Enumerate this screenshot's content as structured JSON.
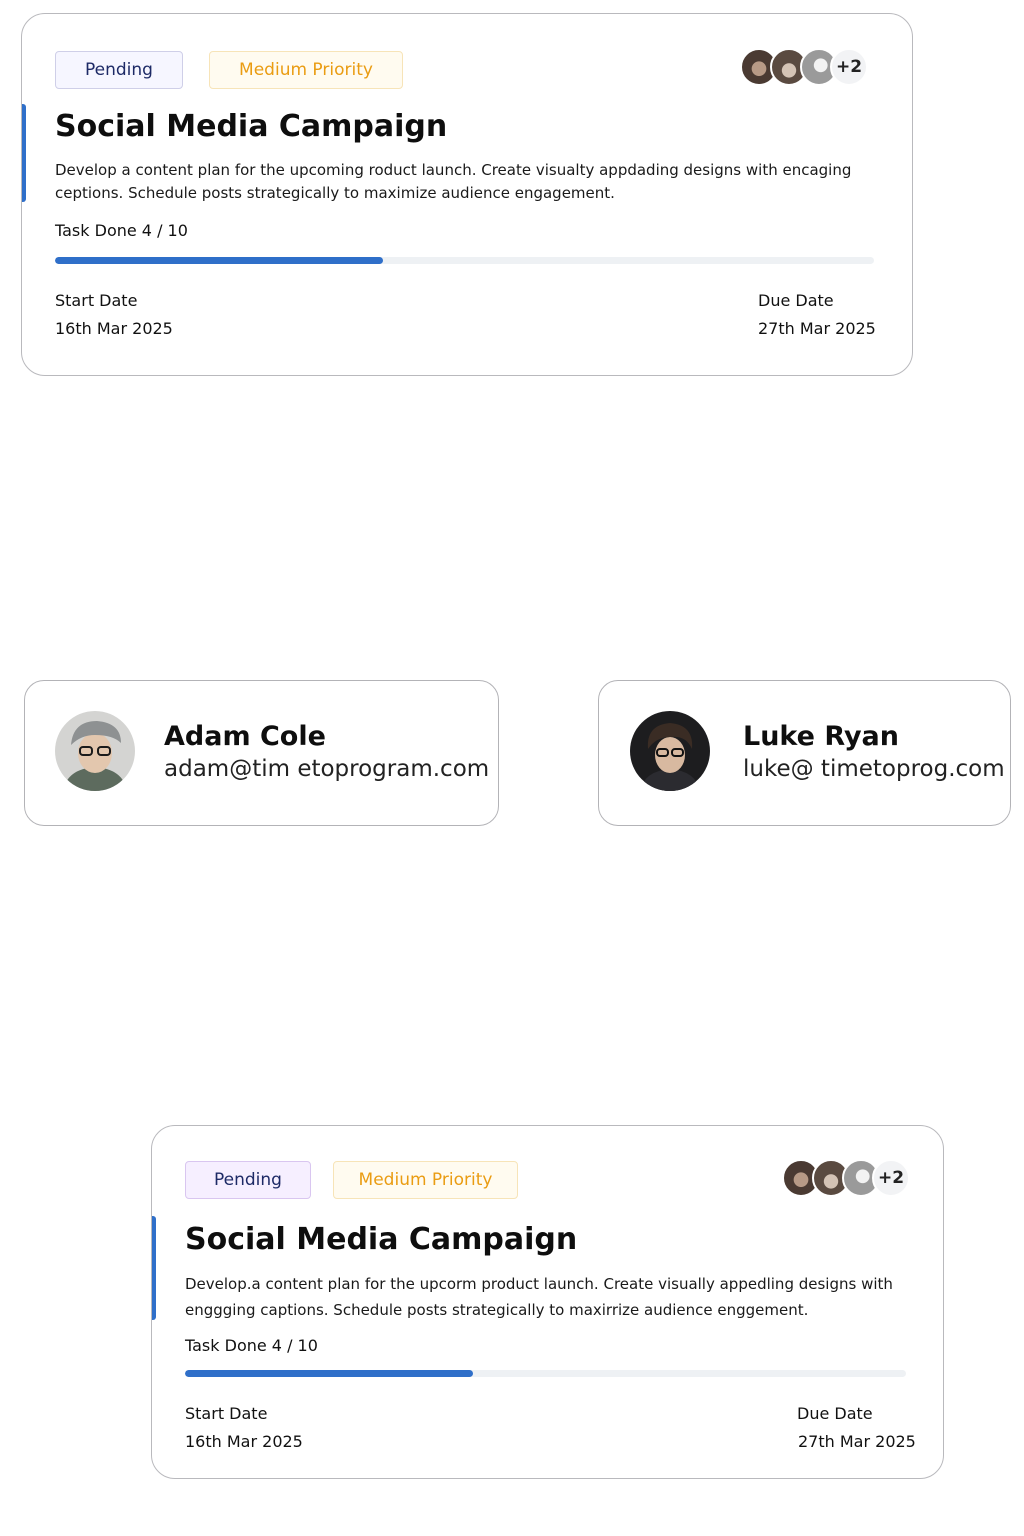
{
  "task_cards": [
    {
      "status": "Pending",
      "priority": "Medium Priority",
      "more_assignees": "+2",
      "title": "Social Media Campaign",
      "description": "Develop a content plan for the upcoming roduct launch. Create visualty appdading designs with encaging ceptions. Schedule posts strategically to maximize audience engagement.",
      "tasks_label": "Task Done 4 / 10",
      "progress": 0.4,
      "start_label": "Start Date",
      "start_value": "16th Mar 2025",
      "due_label": "Due Date",
      "due_value": "27th Mar 2025"
    },
    {
      "status": "Pending",
      "priority": "Medium Priority",
      "more_assignees": "+2",
      "title": "Social Media Campaign",
      "description": "Develop.a content plan for the upcorm product launch.  Create visually appedling designs with enggging captions.  Schedule posts strategically to maxirrize audience enggement.",
      "tasks_label": "Task Done 4 / 10",
      "progress": 0.4,
      "start_label": "Start Date",
      "start_value": "16th Mar 2025",
      "due_label": "Due Date",
      "due_value": "27th Mar 2025"
    }
  ],
  "users": [
    {
      "name": "Adam Cole",
      "email": "adam@tim etoprogram.com"
    },
    {
      "name": "Luke Ryan",
      "email": "luke@ timetoprog.com"
    }
  ],
  "colors": {
    "accent": "#2f6fc9",
    "pending_text": "#1d2a66",
    "priority_text": "#ea9c12"
  },
  "icons": {
    "avatar": "avatar-icon"
  }
}
